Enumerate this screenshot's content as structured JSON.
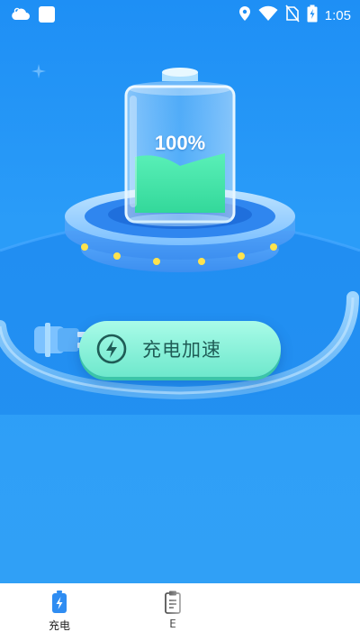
{
  "status_bar": {
    "time": "1:05",
    "left_icons": [
      "cloud-icon",
      "notification-square-icon"
    ],
    "right_icons": [
      "location-icon",
      "wifi-icon",
      "no-sim-icon",
      "battery-charging-icon"
    ]
  },
  "battery": {
    "percent_label": "100%",
    "level": 1.0
  },
  "boost_button": {
    "label": "充电加速",
    "icon": "lightning-icon"
  },
  "bottom_nav": {
    "items": [
      {
        "label": "充电",
        "icon": "battery-charging-icon",
        "active": true
      },
      {
        "label": "E",
        "icon": "clipboard-icon",
        "active": false
      }
    ]
  },
  "colors": {
    "background": "#2a9cf8",
    "accent_green": "#3fe0a0",
    "button_fill": "#7cefd3",
    "button_text": "#1f5c56",
    "active_nav": "#2f8df2"
  }
}
